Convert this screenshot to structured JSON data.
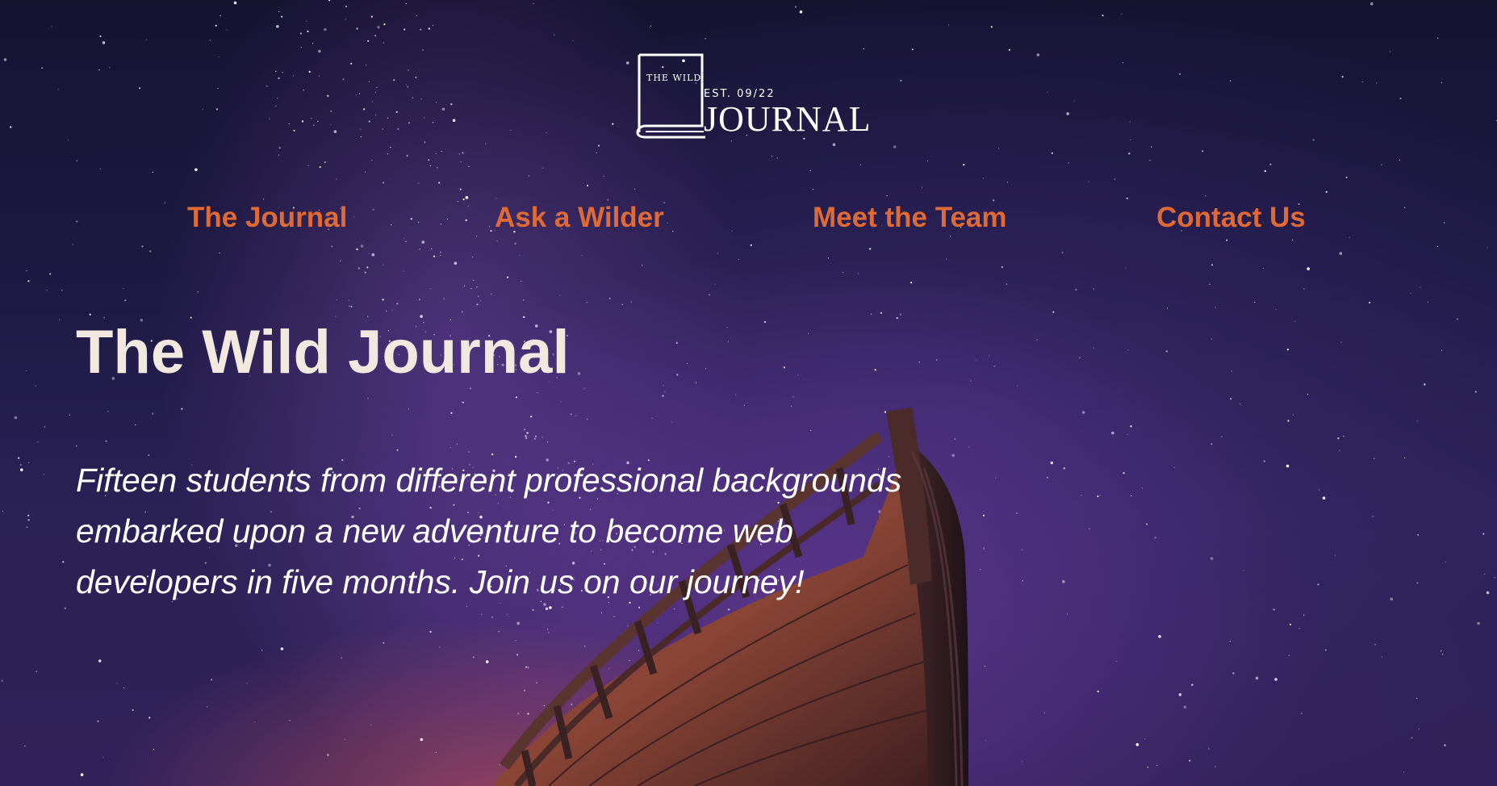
{
  "logo": {
    "small_text": "THE WILD",
    "est_text": "EST. 09/22",
    "main_text": "JOURNAL"
  },
  "nav": {
    "items": [
      {
        "label": "The Journal"
      },
      {
        "label": "Ask a Wilder"
      },
      {
        "label": "Meet the Team"
      },
      {
        "label": "Contact Us"
      }
    ]
  },
  "hero": {
    "title": "The Wild Journal",
    "tagline": "Fifteen students from different professional backgrounds embarked upon a new adventure to become web developers in five months. Join us on our journey!"
  },
  "colors": {
    "nav_link": "#e06a35",
    "title": "#f1e9df",
    "tagline": "#ffffff",
    "sky_dark": "#161331",
    "sky_purple": "#7e42aa",
    "glow_pink": "#d65860"
  }
}
